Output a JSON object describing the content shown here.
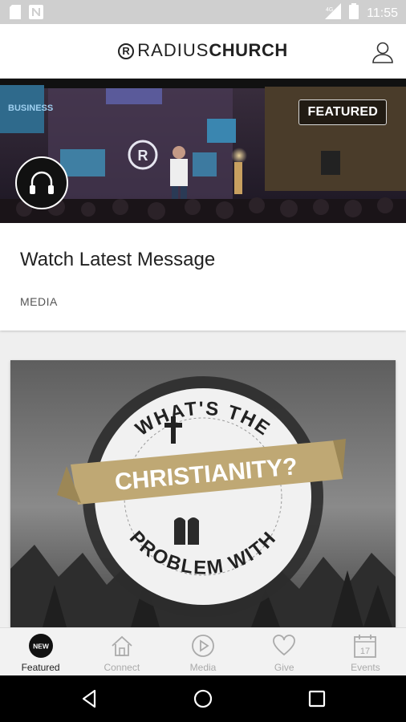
{
  "status_bar": {
    "time": "11:55"
  },
  "header": {
    "brand_light": "RADIUS",
    "brand_bold": "CHURCH",
    "brand_mark": "R"
  },
  "featured_card": {
    "badge": "FEATURED",
    "title": "Watch Latest Message",
    "category": "MEDIA",
    "stage_screen_text": "BUSINESS"
  },
  "artwork": {
    "line_top": "WHAT'S THE",
    "banner": "CHRISTIANITY?",
    "line_bottom": "PROBLEM WITH"
  },
  "tabs": [
    {
      "label": "Featured",
      "icon": "new-badge-icon",
      "active": true,
      "badge": "NEW"
    },
    {
      "label": "Connect",
      "icon": "home-icon",
      "active": false
    },
    {
      "label": "Media",
      "icon": "play-icon",
      "active": false
    },
    {
      "label": "Give",
      "icon": "heart-icon",
      "active": false
    },
    {
      "label": "Events",
      "icon": "calendar-icon",
      "active": false,
      "date": "17"
    }
  ],
  "colors": {
    "status_bar": "#cfcfcf",
    "banner_gold": "#bfa874",
    "tab_active": "#222222",
    "tab_inactive": "#aaaaaa"
  }
}
